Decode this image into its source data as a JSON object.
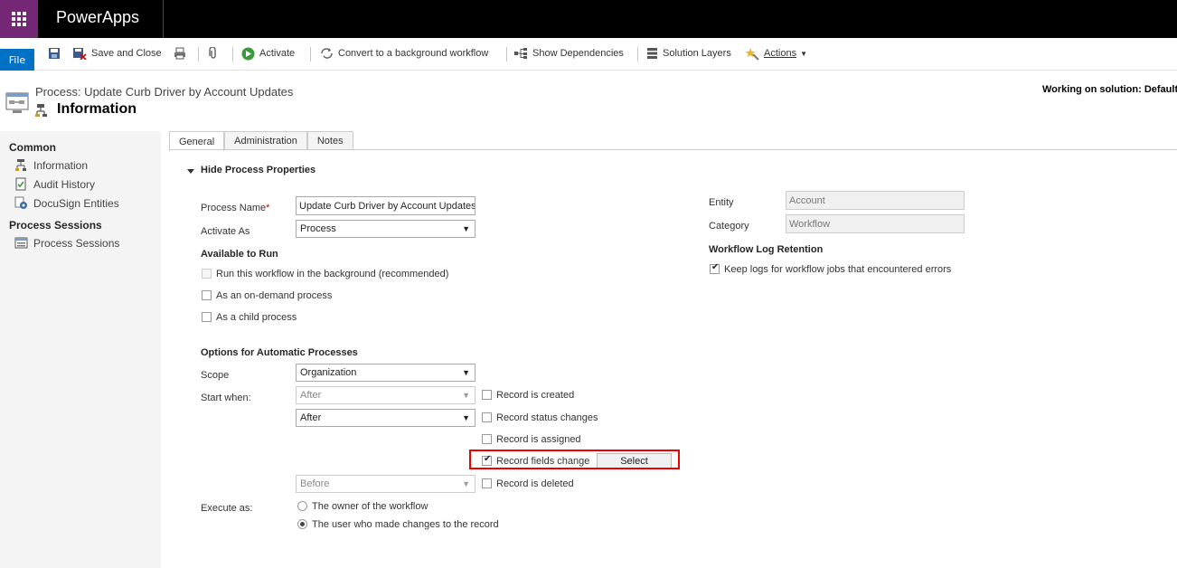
{
  "app": {
    "title": "PowerApps"
  },
  "ribbon": {
    "file": "File",
    "save_and_close": "Save and Close",
    "activate": "Activate",
    "convert": "Convert to a background workflow",
    "show_dependencies": "Show Dependencies",
    "solution_layers": "Solution Layers",
    "actions": "Actions"
  },
  "header": {
    "subtitle": "Process: Update Curb Driver by Account Updates",
    "title": "Information",
    "solution": "Working on solution: Default"
  },
  "nav": {
    "common": "Common",
    "items": [
      {
        "label": "Information"
      },
      {
        "label": "Audit History"
      },
      {
        "label": "DocuSign Entities"
      }
    ],
    "sessions_group": "Process Sessions",
    "sessions_item": "Process Sessions"
  },
  "tabs": [
    {
      "label": "General"
    },
    {
      "label": "Administration"
    },
    {
      "label": "Notes"
    }
  ],
  "form": {
    "section_toggle": "Hide Process Properties",
    "process_name_label": "Process Name",
    "required_mark": "*",
    "process_name_value": "Update Curb Driver by Account Updates",
    "activate_as_label": "Activate As",
    "activate_as_value": "Process",
    "available_heading": "Available to Run",
    "run_background": "Run this workflow in the background (recommended)",
    "on_demand": "As an on-demand process",
    "child_process": "As a child process",
    "options_heading": "Options for Automatic Processes",
    "scope_label": "Scope",
    "scope_value": "Organization",
    "start_when_label": "Start when:",
    "triggers": [
      {
        "timing": "After",
        "label": "Record is created",
        "checked": false
      },
      {
        "timing": "After",
        "label": "Record status changes",
        "checked": false
      },
      {
        "timing": "",
        "label": "Record is assigned",
        "checked": false
      },
      {
        "timing": "",
        "label": "Record fields change",
        "checked": true
      },
      {
        "timing": "Before",
        "label": "Record is deleted",
        "checked": false
      }
    ],
    "select_button": "Select",
    "execute_as_label": "Execute as:",
    "execute_owner": "The owner of the workflow",
    "execute_user": "The user who made changes to the record",
    "entity_label": "Entity",
    "entity_value": "Account",
    "category_label": "Category",
    "category_value": "Workflow",
    "log_heading": "Workflow Log Retention",
    "keep_logs": "Keep logs for workflow jobs that encountered errors"
  }
}
